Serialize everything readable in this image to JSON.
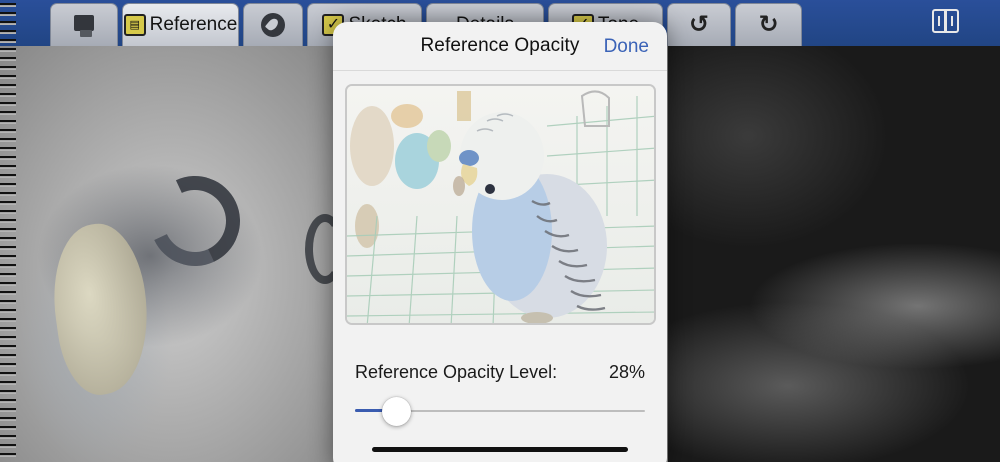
{
  "toolbar": {
    "tabs": [
      {
        "label": "",
        "icon": "layers-icon"
      },
      {
        "label": "Reference",
        "icon": "ruler-checkbox-icon"
      },
      {
        "label": "",
        "icon": "brush-icon"
      },
      {
        "label": "Sketch",
        "icon": "checkbox-icon"
      },
      {
        "label": "Details",
        "icon": ""
      },
      {
        "label": "Tone",
        "icon": "checkbox-icon"
      },
      {
        "label": "",
        "icon": "undo-icon"
      },
      {
        "label": "",
        "icon": "redo-icon"
      }
    ],
    "right_icon": "book-icon"
  },
  "popover": {
    "title": "Reference Opacity",
    "done_label": "Done",
    "preview_image": "parakeet-photo",
    "level_label": "Reference Opacity Level:",
    "level_value": "28%",
    "opacity_fraction": 0.14
  },
  "colors": {
    "toolbar_blue": "#214584",
    "accent_blue": "#3b63b7",
    "popover_bg": "#f2f2f2"
  }
}
